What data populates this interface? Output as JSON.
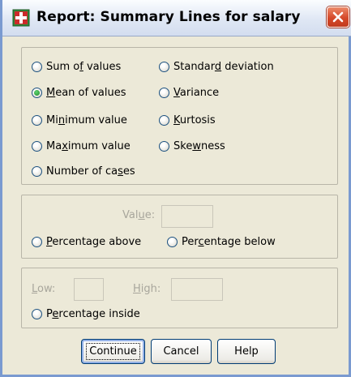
{
  "window": {
    "title": "Report: Summary Lines for salary",
    "icon": "spss-report-icon",
    "close_icon": "close-icon"
  },
  "summary_group": {
    "options": [
      {
        "label_pre": "Sum o",
        "label_u": "f",
        "label_post": " values",
        "checked": false
      },
      {
        "label_pre": "",
        "label_u": "M",
        "label_post": "ean of values",
        "checked": true
      },
      {
        "label_pre": "Mi",
        "label_u": "n",
        "label_post": "imum value",
        "checked": false
      },
      {
        "label_pre": "Ma",
        "label_u": "x",
        "label_post": "imum value",
        "checked": false
      },
      {
        "label_pre": "Number of ca",
        "label_u": "s",
        "label_post": "es",
        "checked": false
      },
      {
        "label_pre": "Standar",
        "label_u": "d",
        "label_post": " deviation",
        "checked": false
      },
      {
        "label_pre": "",
        "label_u": "V",
        "label_post": "ariance",
        "checked": false
      },
      {
        "label_pre": "",
        "label_u": "K",
        "label_post": "urtosis",
        "checked": false
      },
      {
        "label_pre": "Ske",
        "label_u": "w",
        "label_post": "ness",
        "checked": false
      }
    ]
  },
  "percentage_group": {
    "value_label_pre": "Val",
    "value_label_u": "u",
    "value_label_post": "e:",
    "value": "",
    "above_pre": "",
    "above_u": "P",
    "above_post": "ercentage above",
    "below_pre": "Per",
    "below_u": "c",
    "below_post": "entage below"
  },
  "range_group": {
    "low_pre": "",
    "low_u": "L",
    "low_post": "ow:",
    "high_pre": "",
    "high_u": "H",
    "high_post": "igh:",
    "low_value": "",
    "high_value": "",
    "inside_pre": "P",
    "inside_u": "e",
    "inside_post": "rcentage inside"
  },
  "buttons": {
    "continue": "Continue",
    "cancel": "Cancel",
    "help": "Help"
  }
}
